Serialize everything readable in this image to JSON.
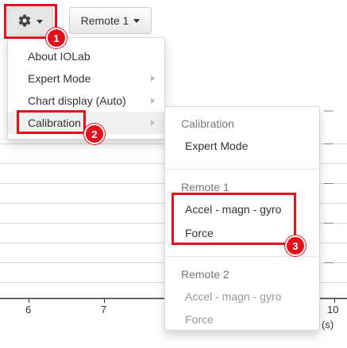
{
  "toolbar": {
    "gear_icon": "gear-icon",
    "remote_label": "Remote 1"
  },
  "main_menu": {
    "items": [
      {
        "label": "About IOLab",
        "has_submenu": false
      },
      {
        "label": "Expert Mode",
        "has_submenu": true
      },
      {
        "label": "Chart display (Auto)",
        "has_submenu": true
      },
      {
        "label": "Calibration",
        "has_submenu": true,
        "active": true
      }
    ]
  },
  "calibration_menu": {
    "sections": [
      {
        "header": "Calibration",
        "items": [
          {
            "label": "Expert Mode",
            "enabled": true
          }
        ]
      },
      {
        "header": "Remote 1",
        "items": [
          {
            "label": "Accel - magn - gyro",
            "enabled": true
          },
          {
            "label": "Force",
            "enabled": true
          }
        ]
      },
      {
        "header": "Remote 2",
        "items": [
          {
            "label": "Accel - magn - gyro",
            "enabled": false
          },
          {
            "label": "Force",
            "enabled": false
          }
        ]
      }
    ]
  },
  "annotations": {
    "badge_1": "1",
    "badge_2": "2",
    "badge_3": "3",
    "color": "#e3101c"
  },
  "chart": {
    "x_ticks": [
      "6",
      "7",
      "10"
    ],
    "x_unit": "(s)"
  }
}
